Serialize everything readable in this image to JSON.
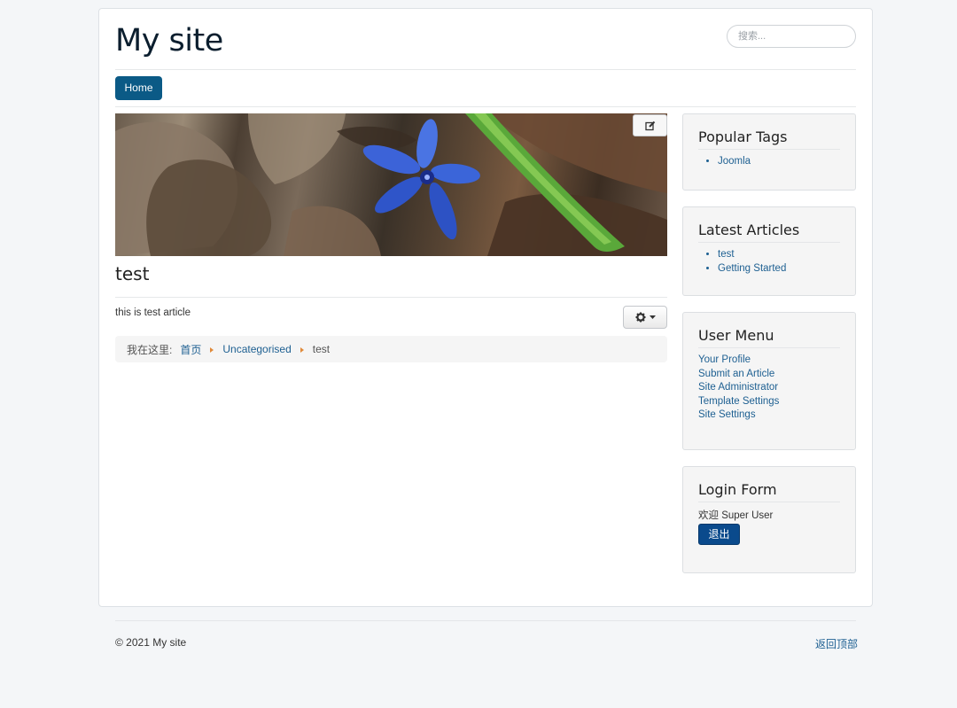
{
  "header": {
    "site_title": "My site",
    "search_placeholder": "搜索..."
  },
  "nav": {
    "items": [
      {
        "label": "Home"
      }
    ]
  },
  "article": {
    "title": "test",
    "text": "this is test article",
    "image": "blue-flower-photo"
  },
  "breadcrumb": {
    "label": "我在这里:",
    "items": [
      "首页",
      "Uncategorised"
    ],
    "current": "test"
  },
  "modules": {
    "popular_tags": {
      "title": "Popular Tags",
      "items": [
        "Joomla"
      ]
    },
    "latest_articles": {
      "title": "Latest Articles",
      "items": [
        "test",
        "Getting Started"
      ]
    },
    "user_menu": {
      "title": "User Menu",
      "items": [
        "Your Profile",
        "Submit an Article",
        "Site Administrator",
        "Template Settings",
        "Site Settings"
      ]
    },
    "login_form": {
      "title": "Login Form",
      "greeting": "欢迎 Super User",
      "logout_label": "退出"
    }
  },
  "footer": {
    "copyright": "© 2021 My site",
    "back_to_top": "返回顶部"
  },
  "colors": {
    "brand_blue": "#0b5a86",
    "logout_blue": "#0a4a8c",
    "link": "#1d5f91",
    "page_bg": "#f4f6f8"
  },
  "icons": [
    "edit-icon",
    "gear-icon",
    "caret-down-icon",
    "breadcrumb-separator-icon"
  ]
}
